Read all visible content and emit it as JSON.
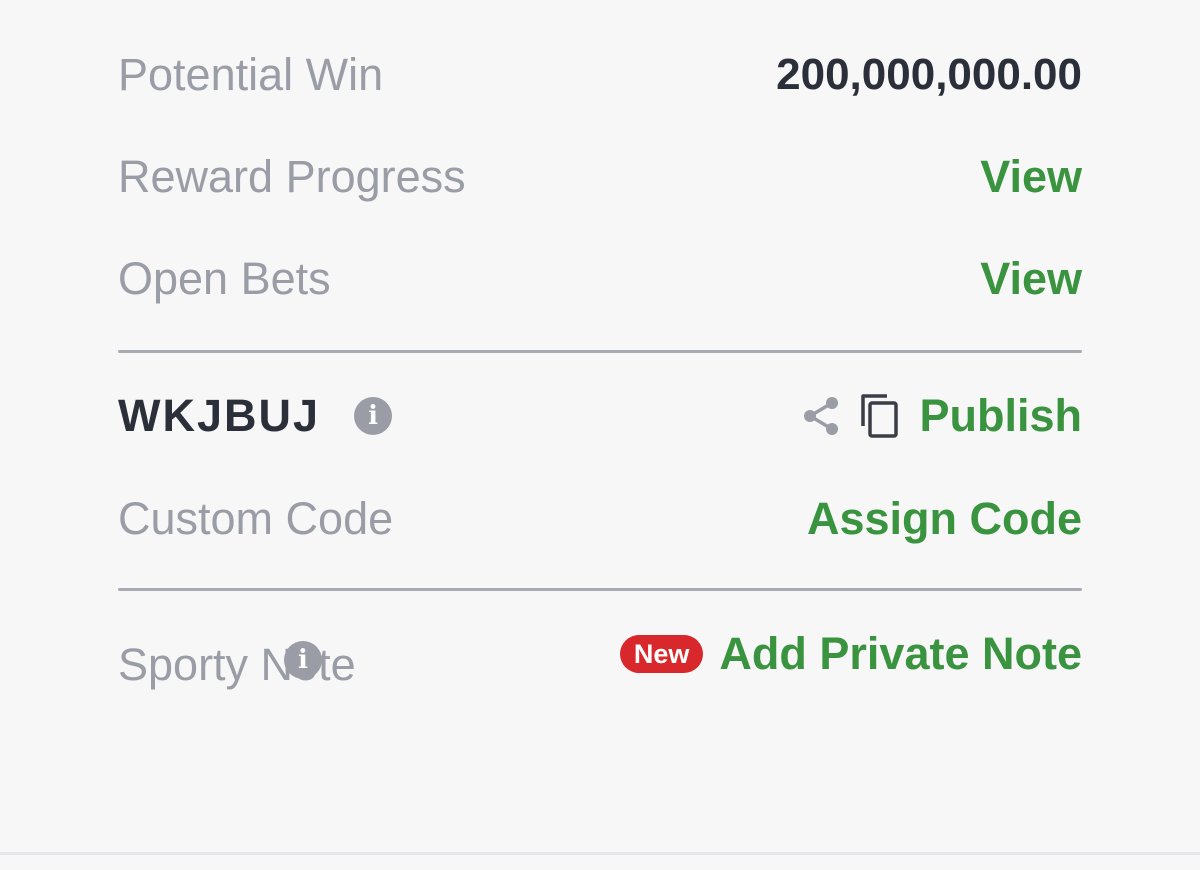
{
  "potential_win": {
    "label": "Potential Win",
    "value": "200,000,000.00"
  },
  "reward_progress": {
    "label": "Reward Progress",
    "action": "View"
  },
  "open_bets": {
    "label": "Open Bets",
    "action": "View"
  },
  "booking": {
    "code": "WKJBUJ",
    "info_icon": "info-icon",
    "share_icon": "share-icon",
    "copy_icon": "copy-icon",
    "publish_label": "Publish"
  },
  "custom_code": {
    "label": "Custom Code",
    "action": "Assign Code"
  },
  "sporty_note": {
    "label": "Sporty Note",
    "info_icon": "info-icon",
    "badge": "New",
    "action": "Add Private Note"
  },
  "colors": {
    "accent_green": "#3a943f",
    "badge_red": "#d8282b",
    "muted_text": "#9a9ca6",
    "strong_text": "#2b2f3a"
  }
}
